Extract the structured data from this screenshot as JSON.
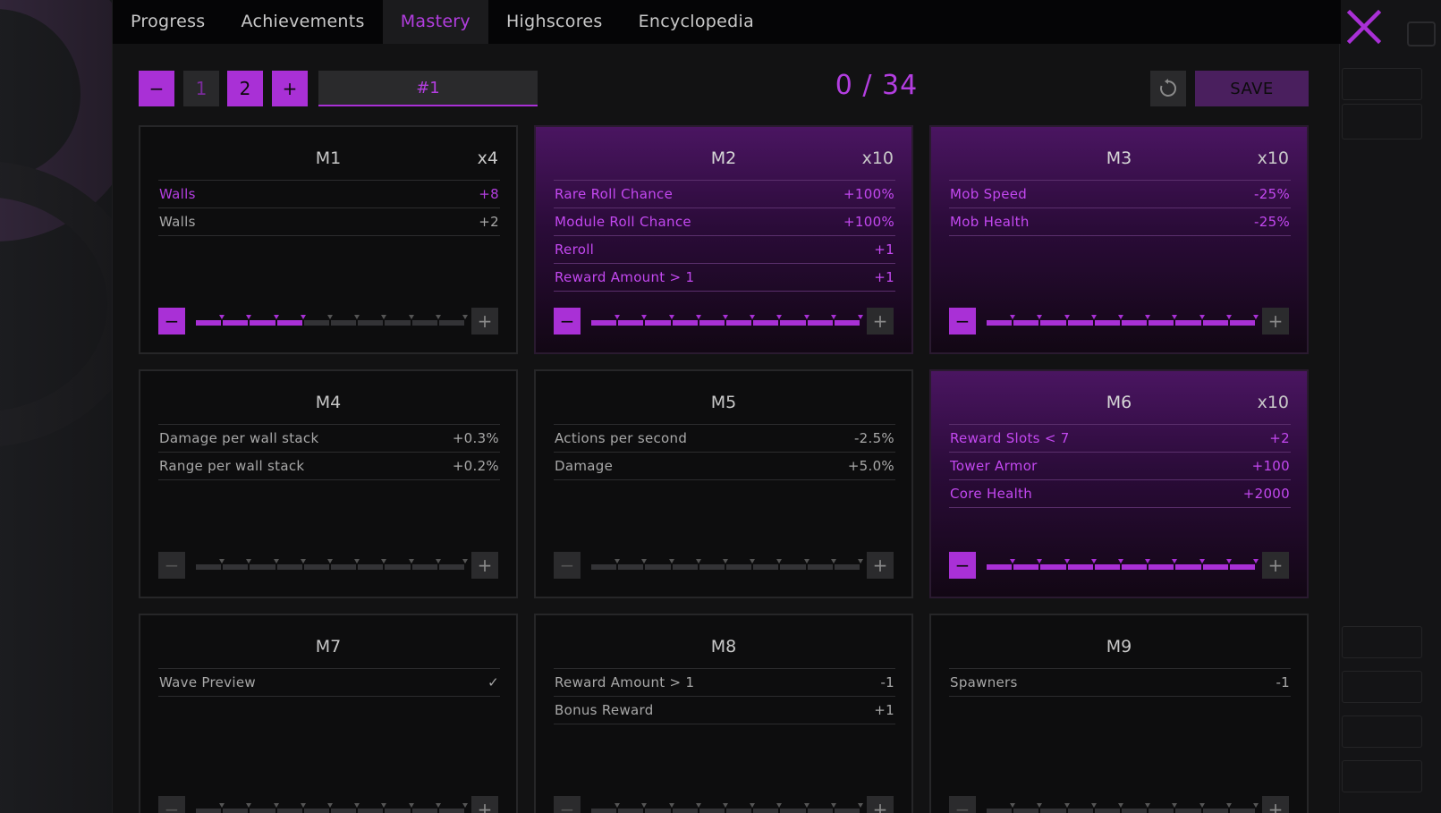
{
  "tabs": [
    {
      "label": "Progress",
      "active": false
    },
    {
      "label": "Achievements",
      "active": false
    },
    {
      "label": "Mastery",
      "active": true
    },
    {
      "label": "Highscores",
      "active": false
    },
    {
      "label": "Encyclopedia",
      "active": false
    }
  ],
  "toolbar": {
    "minus_label": "−",
    "preset_1": "1",
    "preset_2": "2",
    "plus_label": "+",
    "preset_name": "#1",
    "points": "0 / 34",
    "save_label": "SAVE"
  },
  "colors": {
    "accent": "#a930d6",
    "accent_text": "#b33ee0",
    "panel": "#121213",
    "card": "#0d0d0e"
  },
  "cards": [
    {
      "title": "M1",
      "mult": "x4",
      "active": false,
      "level": 4,
      "max_level": 10,
      "stats": [
        {
          "label": "Walls",
          "value": "+8",
          "highlight": true
        },
        {
          "label": "Walls",
          "value": "+2",
          "highlight": false
        }
      ]
    },
    {
      "title": "M2",
      "mult": "x10",
      "active": true,
      "level": 10,
      "max_level": 10,
      "stats": [
        {
          "label": "Rare Roll Chance",
          "value": "+100%",
          "highlight": true
        },
        {
          "label": "Module Roll Chance",
          "value": "+100%",
          "highlight": true
        },
        {
          "label": "Reroll",
          "value": "+1",
          "highlight": true
        },
        {
          "label": "Reward Amount > 1",
          "value": "+1",
          "highlight": true
        }
      ]
    },
    {
      "title": "M3",
      "mult": "x10",
      "active": true,
      "level": 10,
      "max_level": 10,
      "stats": [
        {
          "label": "Mob Speed",
          "value": "-25%",
          "highlight": true
        },
        {
          "label": "Mob Health",
          "value": "-25%",
          "highlight": true
        }
      ]
    },
    {
      "title": "M4",
      "mult": "",
      "active": false,
      "level": 0,
      "max_level": 10,
      "stats": [
        {
          "label": "Damage per wall stack",
          "value": "+0.3%",
          "highlight": false
        },
        {
          "label": "Range per wall stack",
          "value": "+0.2%",
          "highlight": false
        }
      ]
    },
    {
      "title": "M5",
      "mult": "",
      "active": false,
      "level": 0,
      "max_level": 10,
      "stats": [
        {
          "label": "Actions per second",
          "value": "-2.5%",
          "highlight": false
        },
        {
          "label": "Damage",
          "value": "+5.0%",
          "highlight": false
        }
      ]
    },
    {
      "title": "M6",
      "mult": "x10",
      "active": true,
      "level": 10,
      "max_level": 10,
      "stats": [
        {
          "label": "Reward Slots < 7",
          "value": "+2",
          "highlight": true
        },
        {
          "label": "Tower Armor",
          "value": "+100",
          "highlight": true
        },
        {
          "label": "Core Health",
          "value": "+2000",
          "highlight": true
        }
      ]
    },
    {
      "title": "M7",
      "mult": "",
      "active": false,
      "level": 0,
      "max_level": 10,
      "stats": [
        {
          "label": "Wave Preview",
          "value": "✓",
          "highlight": false
        }
      ]
    },
    {
      "title": "M8",
      "mult": "",
      "active": false,
      "level": 0,
      "max_level": 10,
      "stats": [
        {
          "label": "Reward Amount > 1",
          "value": "-1",
          "highlight": false
        },
        {
          "label": "Bonus Reward",
          "value": "+1",
          "highlight": false
        }
      ]
    },
    {
      "title": "M9",
      "mult": "",
      "active": false,
      "level": 0,
      "max_level": 10,
      "stats": [
        {
          "label": "Spawners",
          "value": "-1",
          "highlight": false
        }
      ]
    }
  ]
}
